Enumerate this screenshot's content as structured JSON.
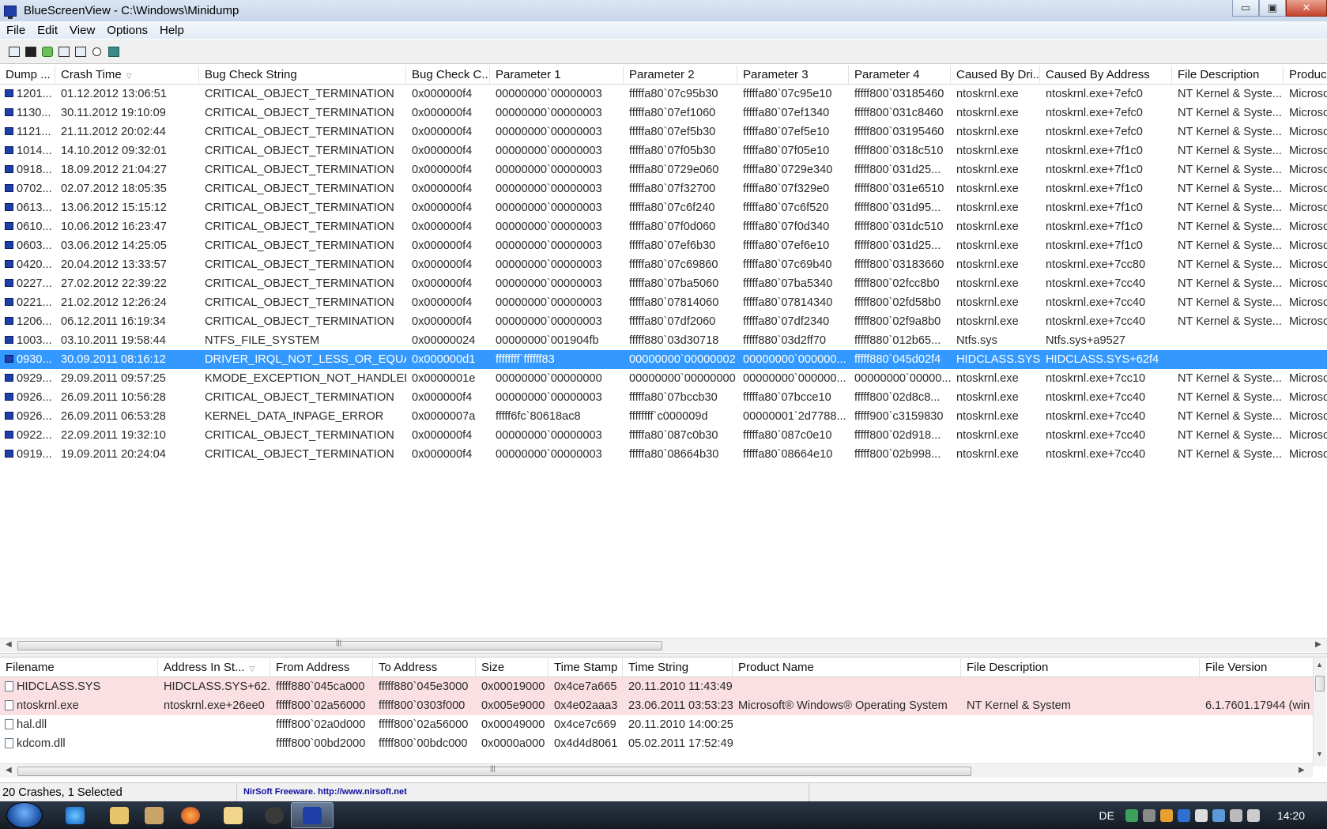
{
  "window": {
    "title": "BlueScreenView  -  C:\\Windows\\Minidump",
    "min": "▭",
    "max": "▣",
    "close": "✕"
  },
  "menu": [
    "File",
    "Edit",
    "View",
    "Options",
    "Help"
  ],
  "toolbar_icons": [
    "properties-icon",
    "save-icon",
    "refresh-icon",
    "copy-icon",
    "options-icon",
    "find-icon",
    "exit-icon"
  ],
  "crash_table": {
    "columns": [
      "Dump ...",
      "Crash Time",
      "Bug Check String",
      "Bug Check C...",
      "Parameter 1",
      "Parameter 2",
      "Parameter 3",
      "Parameter 4",
      "Caused By Dri...",
      "Caused By Address",
      "File Description",
      "Produc"
    ],
    "rows": [
      [
        "1201...",
        "01.12.2012 13:06:51",
        "CRITICAL_OBJECT_TERMINATION",
        "0x000000f4",
        "00000000`00000003",
        "fffffa80`07c95b30",
        "fffffa80`07c95e10",
        "fffff800`03185460",
        "ntoskrnl.exe",
        "ntoskrnl.exe+7efc0",
        "NT Kernel & Syste...",
        "Microso"
      ],
      [
        "1130...",
        "30.11.2012 19:10:09",
        "CRITICAL_OBJECT_TERMINATION",
        "0x000000f4",
        "00000000`00000003",
        "fffffa80`07ef1060",
        "fffffa80`07ef1340",
        "fffff800`031c8460",
        "ntoskrnl.exe",
        "ntoskrnl.exe+7efc0",
        "NT Kernel & Syste...",
        "Microso"
      ],
      [
        "1121...",
        "21.11.2012 20:02:44",
        "CRITICAL_OBJECT_TERMINATION",
        "0x000000f4",
        "00000000`00000003",
        "fffffa80`07ef5b30",
        "fffffa80`07ef5e10",
        "fffff800`03195460",
        "ntoskrnl.exe",
        "ntoskrnl.exe+7efc0",
        "NT Kernel & Syste...",
        "Microso"
      ],
      [
        "1014...",
        "14.10.2012 09:32:01",
        "CRITICAL_OBJECT_TERMINATION",
        "0x000000f4",
        "00000000`00000003",
        "fffffa80`07f05b30",
        "fffffa80`07f05e10",
        "fffff800`0318c510",
        "ntoskrnl.exe",
        "ntoskrnl.exe+7f1c0",
        "NT Kernel & Syste...",
        "Microso"
      ],
      [
        "0918...",
        "18.09.2012 21:04:27",
        "CRITICAL_OBJECT_TERMINATION",
        "0x000000f4",
        "00000000`00000003",
        "fffffa80`0729e060",
        "fffffa80`0729e340",
        "fffff800`031d25...",
        "ntoskrnl.exe",
        "ntoskrnl.exe+7f1c0",
        "NT Kernel & Syste...",
        "Microso"
      ],
      [
        "0702...",
        "02.07.2012 18:05:35",
        "CRITICAL_OBJECT_TERMINATION",
        "0x000000f4",
        "00000000`00000003",
        "fffffa80`07f32700",
        "fffffa80`07f329e0",
        "fffff800`031e6510",
        "ntoskrnl.exe",
        "ntoskrnl.exe+7f1c0",
        "NT Kernel & Syste...",
        "Microso"
      ],
      [
        "0613...",
        "13.06.2012 15:15:12",
        "CRITICAL_OBJECT_TERMINATION",
        "0x000000f4",
        "00000000`00000003",
        "fffffa80`07c6f240",
        "fffffa80`07c6f520",
        "fffff800`031d95...",
        "ntoskrnl.exe",
        "ntoskrnl.exe+7f1c0",
        "NT Kernel & Syste...",
        "Microso"
      ],
      [
        "0610...",
        "10.06.2012 16:23:47",
        "CRITICAL_OBJECT_TERMINATION",
        "0x000000f4",
        "00000000`00000003",
        "fffffa80`07f0d060",
        "fffffa80`07f0d340",
        "fffff800`031dc510",
        "ntoskrnl.exe",
        "ntoskrnl.exe+7f1c0",
        "NT Kernel & Syste...",
        "Microso"
      ],
      [
        "0603...",
        "03.06.2012 14:25:05",
        "CRITICAL_OBJECT_TERMINATION",
        "0x000000f4",
        "00000000`00000003",
        "fffffa80`07ef6b30",
        "fffffa80`07ef6e10",
        "fffff800`031d25...",
        "ntoskrnl.exe",
        "ntoskrnl.exe+7f1c0",
        "NT Kernel & Syste...",
        "Microso"
      ],
      [
        "0420...",
        "20.04.2012 13:33:57",
        "CRITICAL_OBJECT_TERMINATION",
        "0x000000f4",
        "00000000`00000003",
        "fffffa80`07c69860",
        "fffffa80`07c69b40",
        "fffff800`03183660",
        "ntoskrnl.exe",
        "ntoskrnl.exe+7cc80",
        "NT Kernel & Syste...",
        "Microso"
      ],
      [
        "0227...",
        "27.02.2012 22:39:22",
        "CRITICAL_OBJECT_TERMINATION",
        "0x000000f4",
        "00000000`00000003",
        "fffffa80`07ba5060",
        "fffffa80`07ba5340",
        "fffff800`02fcc8b0",
        "ntoskrnl.exe",
        "ntoskrnl.exe+7cc40",
        "NT Kernel & Syste...",
        "Microso"
      ],
      [
        "0221...",
        "21.02.2012 12:26:24",
        "CRITICAL_OBJECT_TERMINATION",
        "0x000000f4",
        "00000000`00000003",
        "fffffa80`07814060",
        "fffffa80`07814340",
        "fffff800`02fd58b0",
        "ntoskrnl.exe",
        "ntoskrnl.exe+7cc40",
        "NT Kernel & Syste...",
        "Microso"
      ],
      [
        "1206...",
        "06.12.2011 16:19:34",
        "CRITICAL_OBJECT_TERMINATION",
        "0x000000f4",
        "00000000`00000003",
        "fffffa80`07df2060",
        "fffffa80`07df2340",
        "fffff800`02f9a8b0",
        "ntoskrnl.exe",
        "ntoskrnl.exe+7cc40",
        "NT Kernel & Syste...",
        "Microso"
      ],
      [
        "1003...",
        "03.10.2011 19:58:44",
        "NTFS_FILE_SYSTEM",
        "0x00000024",
        "00000000`001904fb",
        "fffff880`03d30718",
        "fffff880`03d2ff70",
        "fffff880`012b65...",
        "Ntfs.sys",
        "Ntfs.sys+a9527",
        "",
        ""
      ],
      [
        "0930...",
        "30.09.2011 08:16:12",
        "DRIVER_IRQL_NOT_LESS_OR_EQUAL",
        "0x000000d1",
        "ffffffff`ffffff83",
        "00000000`00000002",
        "00000000`000000...",
        "fffff880`045d02f4",
        "HIDCLASS.SYS",
        "HIDCLASS.SYS+62f4",
        "",
        ""
      ],
      [
        "0929...",
        "29.09.2011 09:57:25",
        "KMODE_EXCEPTION_NOT_HANDLED",
        "0x0000001e",
        "00000000`00000000",
        "00000000`00000000",
        "00000000`000000...",
        "00000000`00000...",
        "ntoskrnl.exe",
        "ntoskrnl.exe+7cc10",
        "NT Kernel & Syste...",
        "Microso"
      ],
      [
        "0926...",
        "26.09.2011 10:56:28",
        "CRITICAL_OBJECT_TERMINATION",
        "0x000000f4",
        "00000000`00000003",
        "fffffa80`07bccb30",
        "fffffa80`07bcce10",
        "fffff800`02d8c8...",
        "ntoskrnl.exe",
        "ntoskrnl.exe+7cc40",
        "NT Kernel & Syste...",
        "Microso"
      ],
      [
        "0926...",
        "26.09.2011 06:53:28",
        "KERNEL_DATA_INPAGE_ERROR",
        "0x0000007a",
        "fffff6fc`80618ac8",
        "ffffffff`c000009d",
        "00000001`2d7788...",
        "fffff900`c3159830",
        "ntoskrnl.exe",
        "ntoskrnl.exe+7cc40",
        "NT Kernel & Syste...",
        "Microso"
      ],
      [
        "0922...",
        "22.09.2011 19:32:10",
        "CRITICAL_OBJECT_TERMINATION",
        "0x000000f4",
        "00000000`00000003",
        "fffffa80`087c0b30",
        "fffffa80`087c0e10",
        "fffff800`02d918...",
        "ntoskrnl.exe",
        "ntoskrnl.exe+7cc40",
        "NT Kernel & Syste...",
        "Microso"
      ],
      [
        "0919...",
        "19.09.2011 20:24:04",
        "CRITICAL_OBJECT_TERMINATION",
        "0x000000f4",
        "00000000`00000003",
        "fffffa80`08664b30",
        "fffffa80`08664e10",
        "fffff800`02b998...",
        "ntoskrnl.exe",
        "ntoskrnl.exe+7cc40",
        "NT Kernel & Syste...",
        "Microso"
      ]
    ],
    "selected_index": 14
  },
  "module_table": {
    "columns": [
      "Filename",
      "Address In St...",
      "From Address",
      "To Address",
      "Size",
      "Time Stamp",
      "Time String",
      "Product Name",
      "File Description",
      "File Version"
    ],
    "rows": [
      [
        "HIDCLASS.SYS",
        "HIDCLASS.SYS+62...",
        "fffff880`045ca000",
        "fffff880`045e3000",
        "0x00019000",
        "0x4ce7a665",
        "20.11.2010 11:43:49",
        "",
        "",
        ""
      ],
      [
        "ntoskrnl.exe",
        "ntoskrnl.exe+26ee0",
        "fffff800`02a56000",
        "fffff800`0303f000",
        "0x005e9000",
        "0x4e02aaa3",
        "23.06.2011 03:53:23",
        "Microsoft® Windows® Operating System",
        "NT Kernel & System",
        "6.1.7601.17944 (win"
      ],
      [
        "hal.dll",
        "",
        "fffff800`02a0d000",
        "fffff800`02a56000",
        "0x00049000",
        "0x4ce7c669",
        "20.11.2010 14:00:25",
        "",
        "",
        ""
      ],
      [
        "kdcom.dll",
        "",
        "fffff800`00bd2000",
        "fffff800`00bdc000",
        "0x0000a000",
        "0x4d4d8061",
        "05.02.2011 17:52:49",
        "",
        "",
        ""
      ]
    ],
    "highlighted_rows": [
      0,
      1
    ]
  },
  "status": {
    "count": "20 Crashes, 1 Selected",
    "credit": "NirSoft Freeware.  http://www.nirsoft.net"
  },
  "taskbar": {
    "lang": "DE",
    "clock": "14:20"
  },
  "colors": {
    "selection": "#3399ff",
    "highlight": "#fbe0e3"
  }
}
